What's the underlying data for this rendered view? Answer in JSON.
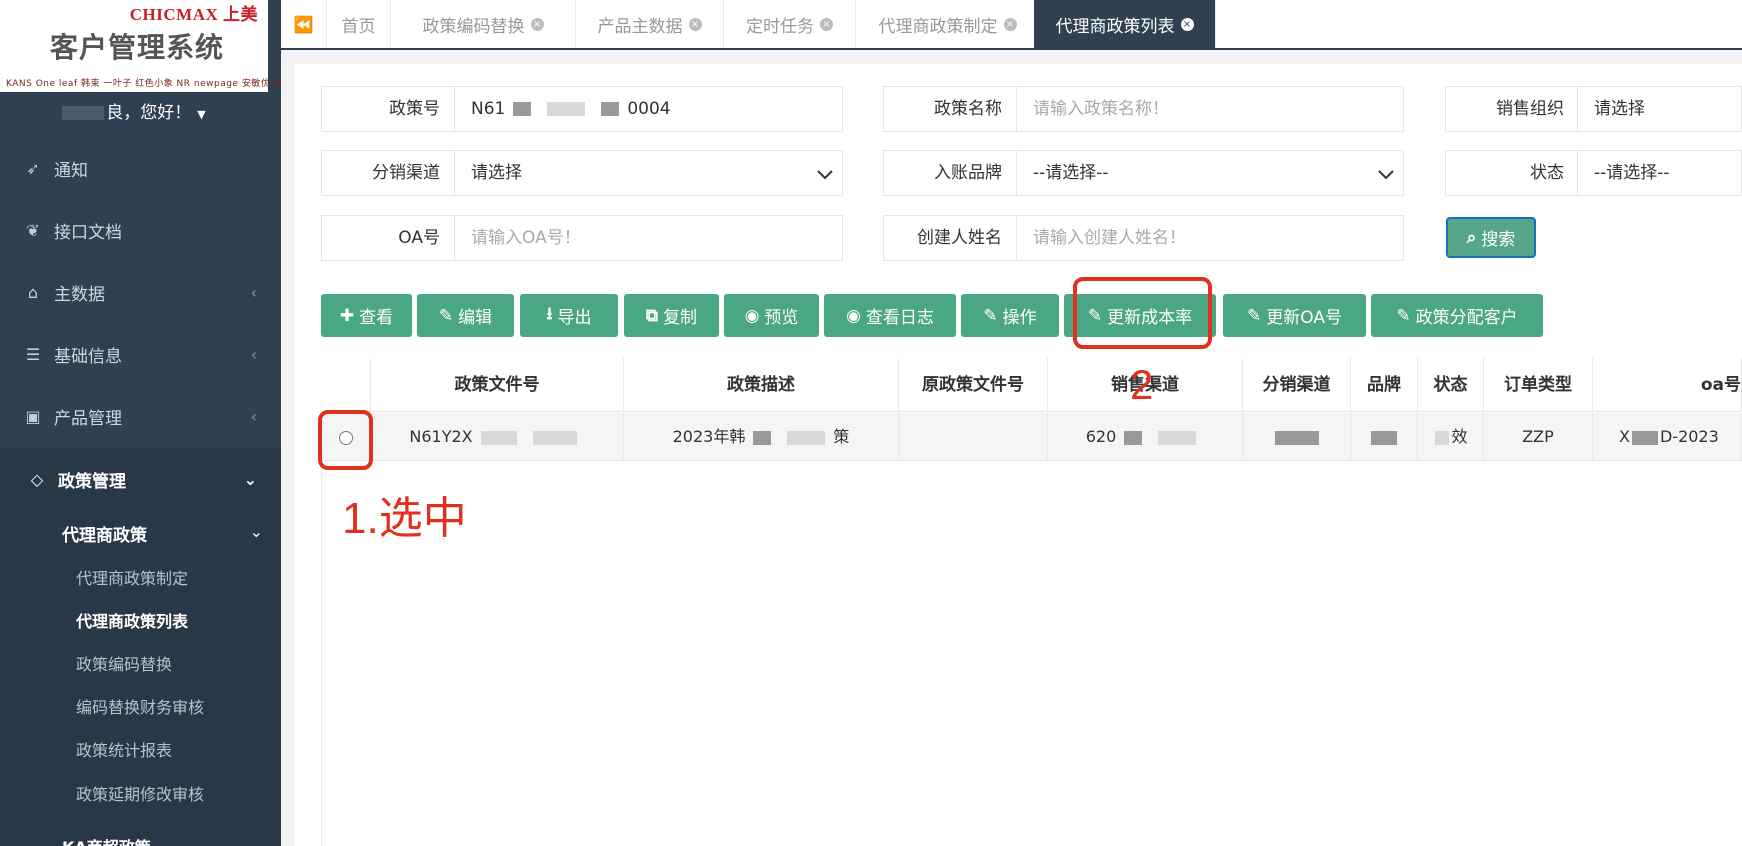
{
  "app": {
    "brand": "CHICMAX 上美",
    "title": "客户管理系统",
    "brand_strip": "KANS One leaf 韩束 一叶子 红色小象 NR newpage 安敏优 极方 SOVYA Ms.Su",
    "welcome": "良，您好！"
  },
  "sidebar": {
    "items": [
      {
        "label": "通知",
        "icon": "rocket-icon"
      },
      {
        "label": "接口文档",
        "icon": "leaf-icon"
      },
      {
        "label": "主数据",
        "icon": "home-icon"
      },
      {
        "label": "基础信息",
        "icon": "list-icon"
      },
      {
        "label": "产品管理",
        "icon": "box-icon"
      },
      {
        "label": "政策管理",
        "icon": "diamond-icon"
      }
    ],
    "submenu_title": "代理商政策",
    "submenu": [
      "代理商政策制定",
      "代理商政策列表",
      "政策编码替换",
      "编码替换财务审核",
      "政策统计报表",
      "政策延期修改审核"
    ],
    "next_group": "KA商超政策"
  },
  "tabs": [
    {
      "label": "首页"
    },
    {
      "label": "政策编码替换"
    },
    {
      "label": "产品主数据"
    },
    {
      "label": "定时任务"
    },
    {
      "label": "代理商政策制定"
    },
    {
      "label": "代理商政策列表"
    }
  ],
  "form": {
    "policy_no": {
      "label": "政策号",
      "prefix": "N61",
      "suffix": "0004"
    },
    "policy_name": {
      "label": "政策名称",
      "placeholder": "请输入政策名称！"
    },
    "sales_org": {
      "label": "销售组织",
      "value": "请选择"
    },
    "channel": {
      "label": "分销渠道",
      "value": "请选择"
    },
    "brand": {
      "label": "入账品牌",
      "value": "--请选择--"
    },
    "status": {
      "label": "状态",
      "value": "--请选择--"
    },
    "oa_no": {
      "label": "OA号",
      "placeholder": "请输入OA号！"
    },
    "creator": {
      "label": "创建人姓名",
      "placeholder": "请输入创建人姓名！"
    },
    "search_label": "搜索"
  },
  "toolbar": {
    "view": "查看",
    "edit": "编辑",
    "export": "导出",
    "copy": "复制",
    "preview": "预览",
    "log": "查看日志",
    "operate": "操作",
    "update_cost": "更新成本率",
    "update_oa": "更新OA号",
    "assign": "政策分配客户"
  },
  "table": {
    "headers": [
      "政策文件号",
      "政策描述",
      "原政策文件号",
      "销售渠道",
      "分销渠道",
      "品牌",
      "状态",
      "订单类型",
      "oa号"
    ],
    "row": {
      "file_no": "N61Y2X",
      "desc_prefix": "2023年韩",
      "desc_suffix": "策",
      "orig_no": "",
      "sales_channel": "620",
      "channel": "",
      "brand": "",
      "status": "效",
      "order_type": "ZZP",
      "oa": "X",
      "oa_tail": "D-2023"
    }
  },
  "annotations": {
    "step1": "1.选中",
    "step2": "2"
  }
}
